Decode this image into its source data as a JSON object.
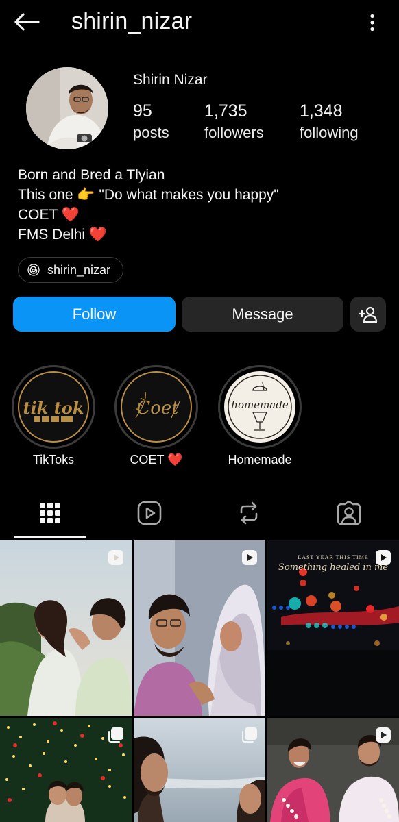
{
  "header": {
    "username": "shirin_nizar",
    "back_icon": "arrow-left-icon",
    "more_icon": "more-vertical-icon"
  },
  "profile": {
    "full_name": "Shirin Nizar",
    "stats": [
      {
        "value": "95",
        "label": "posts"
      },
      {
        "value": "1,735",
        "label": "followers"
      },
      {
        "value": "1,348",
        "label": "following"
      }
    ],
    "bio": [
      {
        "text": "Born and Bred a Tlyian",
        "emoji": ""
      },
      {
        "text": "This one 👉 \"Do what makes you happy\"",
        "emoji": ""
      },
      {
        "text": "COET ",
        "emoji": "❤️"
      },
      {
        "text": "FMS Delhi ",
        "emoji": "❤️"
      }
    ],
    "threads_handle": "shirin_nizar"
  },
  "actions": {
    "follow_label": "Follow",
    "message_label": "Message",
    "suggest_icon": "add-user-icon"
  },
  "highlights": [
    {
      "label": "TikToks",
      "cover_text": "tik tok"
    },
    {
      "label": "COET ",
      "label_emoji": "❤️",
      "cover_text": "Coet"
    },
    {
      "label": "Homemade",
      "cover_text": "homemade"
    }
  ],
  "tabs": [
    {
      "name": "posts-grid",
      "icon": "grid-icon",
      "active": true
    },
    {
      "name": "reels",
      "icon": "reels-icon",
      "active": false
    },
    {
      "name": "reposts",
      "icon": "repost-icon",
      "active": false
    },
    {
      "name": "tagged",
      "icon": "tagged-user-icon",
      "active": false
    }
  ],
  "grid": {
    "posts": [
      {
        "type": "reel",
        "badge_icon": "reel-badge-icon"
      },
      {
        "type": "reel",
        "badge_icon": "reel-badge-icon"
      },
      {
        "type": "reel",
        "badge_icon": "reel-badge-icon",
        "overlay_top": "LAST YEAR THIS TIME",
        "overlay_main": "Something healed in me"
      },
      {
        "type": "carousel",
        "badge_icon": "carousel-badge-icon"
      },
      {
        "type": "carousel",
        "badge_icon": "carousel-badge-icon"
      },
      {
        "type": "reel",
        "badge_icon": "reel-badge-icon"
      }
    ]
  },
  "colors": {
    "background": "#000000",
    "follow_button": "#0a95f6",
    "secondary_button": "#262626",
    "heart": "#ec2a3d",
    "highlight_gold": "#b88f44"
  }
}
